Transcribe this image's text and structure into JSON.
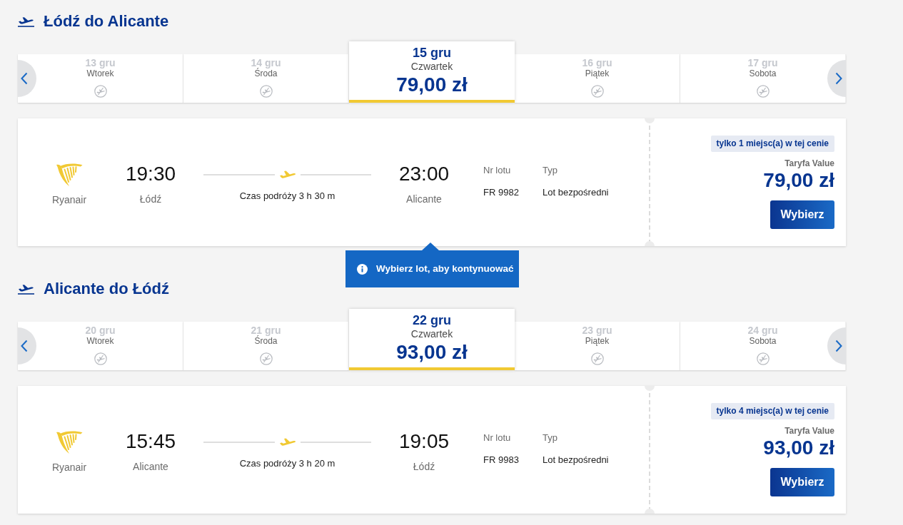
{
  "journeys": [
    {
      "title": "Łódź do Alicante",
      "dates": [
        {
          "date": "13 gru",
          "weekday": "Wtorek",
          "available": false,
          "selected": false
        },
        {
          "date": "14 gru",
          "weekday": "Środa",
          "available": false,
          "selected": false
        },
        {
          "date": "15 gru",
          "weekday": "Czwartek",
          "price": "79,00 zł",
          "available": true,
          "selected": true
        },
        {
          "date": "16 gru",
          "weekday": "Piątek",
          "available": false,
          "selected": false
        },
        {
          "date": "17 gru",
          "weekday": "Sobota",
          "available": false,
          "selected": false
        }
      ],
      "flights": [
        {
          "airline": "Ryanair",
          "depart_time": "19:30",
          "depart_city": "Łódź",
          "duration": "Czas podróży 3 h 30 m",
          "arrive_time": "23:00",
          "arrive_city": "Alicante",
          "flight_no_label": "Nr lotu",
          "flight_no": "FR 9982",
          "type_label": "Typ",
          "type": "Lot bezpośredni",
          "seats_badge": "tylko 1 miejsc(a) w tej cenie",
          "fare_name": "Taryfa Value",
          "price": "79,00 zł",
          "button": "Wybierz"
        }
      ],
      "tooltip": {
        "text": "Wybierz lot, aby kontynuować"
      }
    },
    {
      "title": "Alicante do Łódź",
      "dates": [
        {
          "date": "20 gru",
          "weekday": "Wtorek",
          "available": false,
          "selected": false
        },
        {
          "date": "21 gru",
          "weekday": "Środa",
          "available": false,
          "selected": false
        },
        {
          "date": "22 gru",
          "weekday": "Czwartek",
          "price": "93,00 zł",
          "available": true,
          "selected": true
        },
        {
          "date": "23 gru",
          "weekday": "Piątek",
          "available": false,
          "selected": false
        },
        {
          "date": "24 gru",
          "weekday": "Sobota",
          "available": false,
          "selected": false
        }
      ],
      "flights": [
        {
          "airline": "Ryanair",
          "depart_time": "15:45",
          "depart_city": "Alicante",
          "duration": "Czas podróży 3 h 20 m",
          "arrive_time": "19:05",
          "arrive_city": "Łódź",
          "flight_no_label": "Nr lotu",
          "flight_no": "FR 9983",
          "type_label": "Typ",
          "type": "Lot bezpośredni",
          "seats_badge": "tylko 4 miejsc(a) w tej cenie",
          "fare_name": "Taryfa Value",
          "price": "93,00 zł",
          "button": "Wybierz"
        }
      ]
    }
  ]
}
